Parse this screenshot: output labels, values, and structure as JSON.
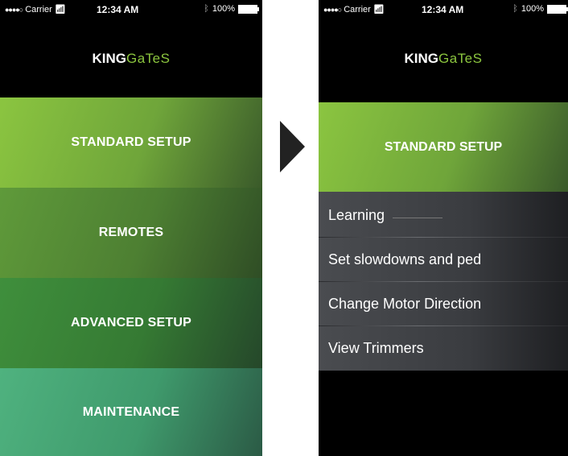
{
  "status_bar": {
    "signal": "●●●●○",
    "carrier": "Carrier",
    "time": "12:34 AM",
    "battery": "100%"
  },
  "logo": {
    "part1": "KING",
    "part2": "GaTeS"
  },
  "left_screen": {
    "menu": [
      {
        "label": "STANDARD SETUP"
      },
      {
        "label": "REMOTES"
      },
      {
        "label": "ADVANCED SETUP"
      },
      {
        "label": "MAINTENANCE"
      }
    ]
  },
  "right_screen": {
    "header_tile": "STANDARD SETUP",
    "submenu": [
      {
        "label": "Learning"
      },
      {
        "label": "Set slowdowns and ped"
      },
      {
        "label": "Change Motor Direction"
      },
      {
        "label": "View Trimmers"
      }
    ]
  },
  "colors": {
    "brand_green": "#8cc63f",
    "background": "#000000"
  }
}
